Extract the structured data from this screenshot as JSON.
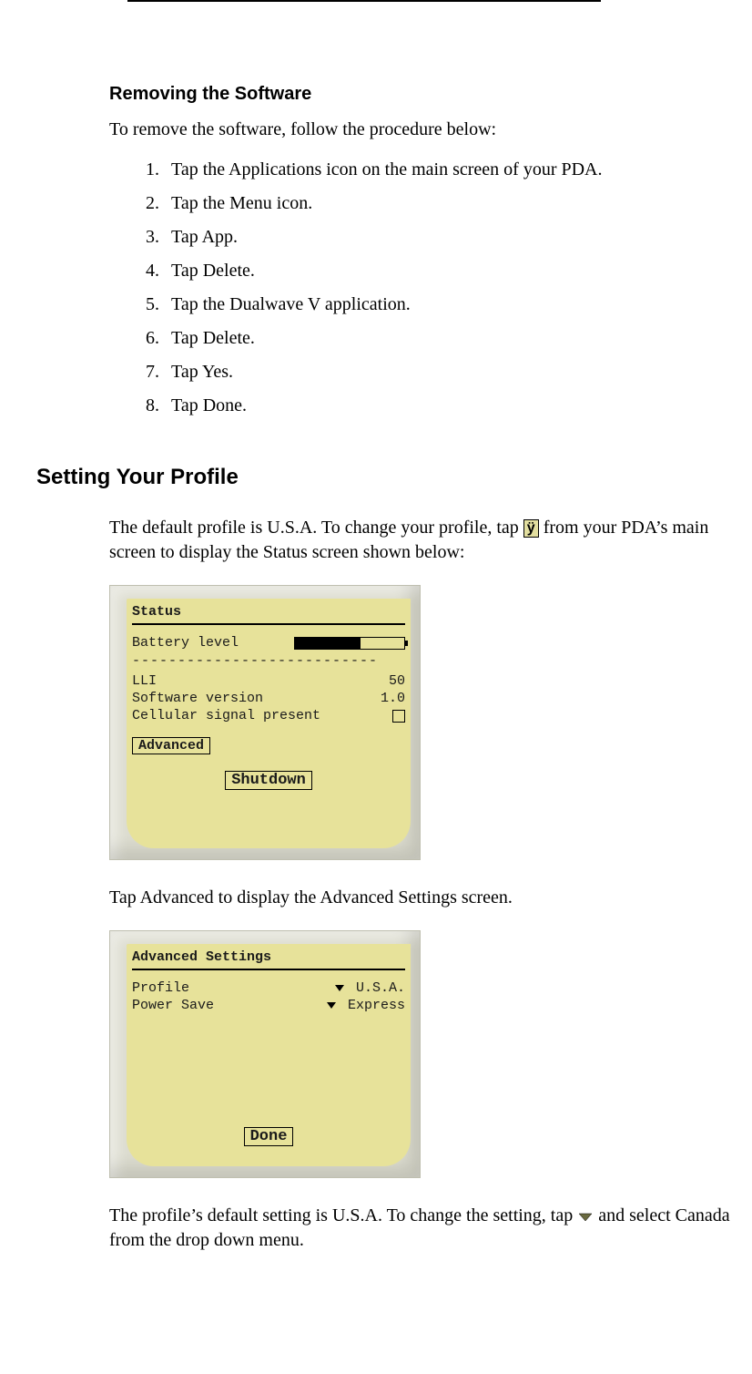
{
  "section_removing": {
    "heading": "Removing the Software",
    "intro": "To remove the software, follow the procedure below:",
    "steps": [
      "Tap the Applications icon on the main screen of your PDA.",
      "Tap the Menu icon.",
      "Tap App.",
      "Tap Delete.",
      "Tap the Dualwave V application.",
      "Tap Delete.",
      "Tap Yes.",
      "Tap Done."
    ]
  },
  "section_profile": {
    "heading": "Setting Your Profile",
    "para1_a": "The default profile is U.S.A. To change your profile, tap ",
    "para1_icon_glyph": "ÿ",
    "para1_b": " from your PDA’s main screen to display the Status screen shown below:",
    "para2": "Tap Advanced to display the Advanced Settings screen.",
    "para3_a": "The profile’s default setting is U.S.A. To change the setting, tap ",
    "para3_b": " and select Canada from the drop down menu."
  },
  "status_screen": {
    "title": "Status",
    "battery_label": "Battery level",
    "battery_fill_pct": 60,
    "dashes": "---------------------------",
    "lli_label": "LLI",
    "lli_value": "50",
    "sw_label": "Software version",
    "sw_value": "1.0",
    "cell_label": "Cellular signal present",
    "advanced_btn": "Advanced",
    "shutdown_btn": "Shutdown"
  },
  "advanced_screen": {
    "title": "Advanced Settings",
    "profile_label": "Profile",
    "profile_value": "U.S.A.",
    "power_label": "Power Save",
    "power_value": "Express",
    "done_btn": "Done"
  }
}
